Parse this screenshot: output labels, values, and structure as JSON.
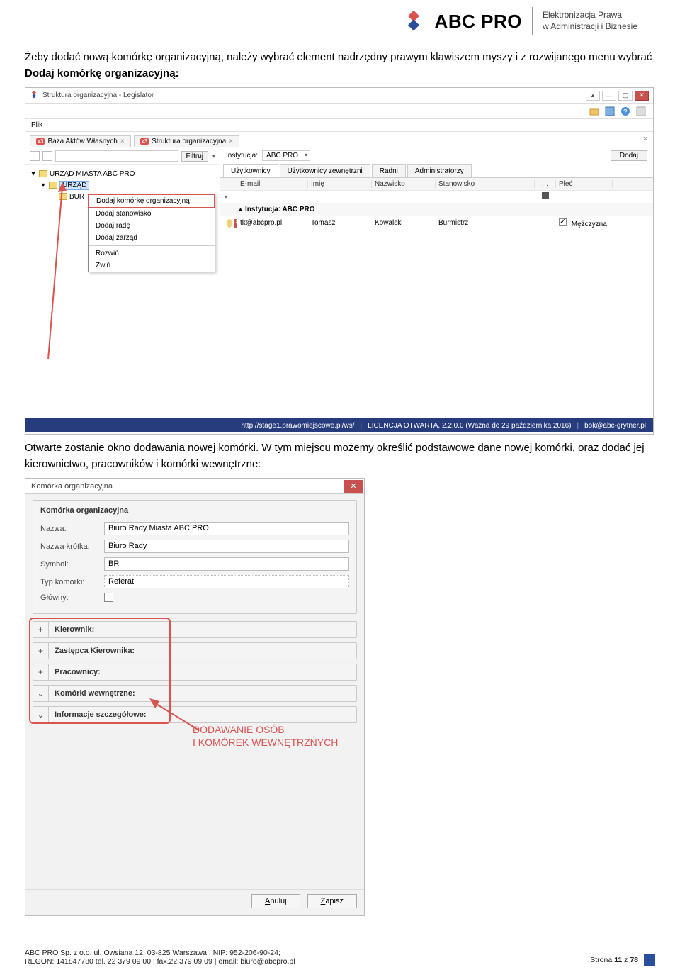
{
  "header": {
    "brand": "ABC PRO",
    "sub1": "Elektronizacja Prawa",
    "sub2": "w Administracji i Biznesie"
  },
  "instruction1": {
    "p1": "Żeby dodać nową komórkę organizacyjną, należy wybrać element nadrzędny prawym klawiszem myszy i z rozwijanego menu wybrać ",
    "bold": "Dodaj komórkę organizacyjną:"
  },
  "screenshot1": {
    "windowTitle": "Struktura organizacyjna - Legislator",
    "menu_plik": "Plik",
    "tab1": "Baza Aktów Własnych",
    "tab2": "Struktura organizacyjna",
    "filter_btn": "Filtruj",
    "tree": {
      "root": "URZĄD MIASTA ABC PRO",
      "child1": "URZĄD",
      "child2": "BUR"
    },
    "context": {
      "item1": "Dodaj komórkę organizacyjną",
      "item2": "Dodaj stanowisko",
      "item3": "Dodaj radę",
      "item4": "Dodaj zarząd",
      "item5": "Rozwiń",
      "item6": "Zwiń"
    },
    "right": {
      "inst_label": "Instytucja:",
      "inst_value": "ABC PRO",
      "dodaj_btn": "Dodaj",
      "tabs": {
        "t1": "Użytkownicy",
        "t2": "Użytkownicy zewnętrzni",
        "t3": "Radni",
        "t4": "Administratorzy"
      },
      "cols": {
        "email": "E-mail",
        "imie": "Imię",
        "nazwisko": "Nazwisko",
        "stanowisko": "Stanowisko",
        "dots": "…",
        "plec": "Płeć"
      },
      "group_label": "Instytucja: ABC PRO",
      "row": {
        "email": "tk@abcpro.pl",
        "imie": "Tomasz",
        "nazwisko": "Kowalski",
        "stanowisko": "Burmistrz",
        "plec": "Mężczyzna"
      }
    },
    "status": {
      "url": "http://stage1.prawomiejscowe.pl/ws/",
      "lic": "LICENCJA OTWARTA, 2.2.0.0 (Ważna do 29 października 2016)",
      "mail": "bok@abc-grytner.pl"
    }
  },
  "instruction2": "Otwarte zostanie okno dodawania nowej komórki. W tym miejscu możemy określić podstawowe dane nowej komórki, oraz dodać jej kierownictwo, pracowników i komórki wewnętrzne:",
  "screenshot2": {
    "title": "Komórka organizacyjna",
    "group_title": "Komórka organizacyjna",
    "fields": {
      "nazwa_lbl": "Nazwa:",
      "nazwa_val": "Biuro Rady Miasta ABC PRO",
      "krotka_lbl": "Nazwa krótka:",
      "krotka_val": "Biuro Rady",
      "symbol_lbl": "Symbol:",
      "symbol_val": "BR",
      "typ_lbl": "Typ komórki:",
      "typ_val": "Referat",
      "glowny_lbl": "Główny:"
    },
    "exp": {
      "e1": "Kierownik:",
      "e2": "Zastępca Kierownika:",
      "e3": "Pracownicy:",
      "e4": "Komórki wewnętrzne:",
      "e5": "Informacje szczegółowe:"
    },
    "callout_l1": "DODAWANIE OSÓB",
    "callout_l2": "I KOMÓREK WEWNĘTRZNYCH",
    "btn_anuluj": "Anuluj",
    "btn_zapisz": "Zapisz"
  },
  "footer": {
    "l1": "ABC PRO Sp. z o.o.  ul. Owsiana 12;  03-825 Warszawa ; NIP: 952-206-90-24;",
    "l2": "REGON: 141847780 tel. 22 379 09 00 | fax.22 379 09 09 | email: biuro@abcpro.pl",
    "page_prefix": "Strona ",
    "page_num": "11",
    "page_mid": " z ",
    "page_total": "78"
  }
}
